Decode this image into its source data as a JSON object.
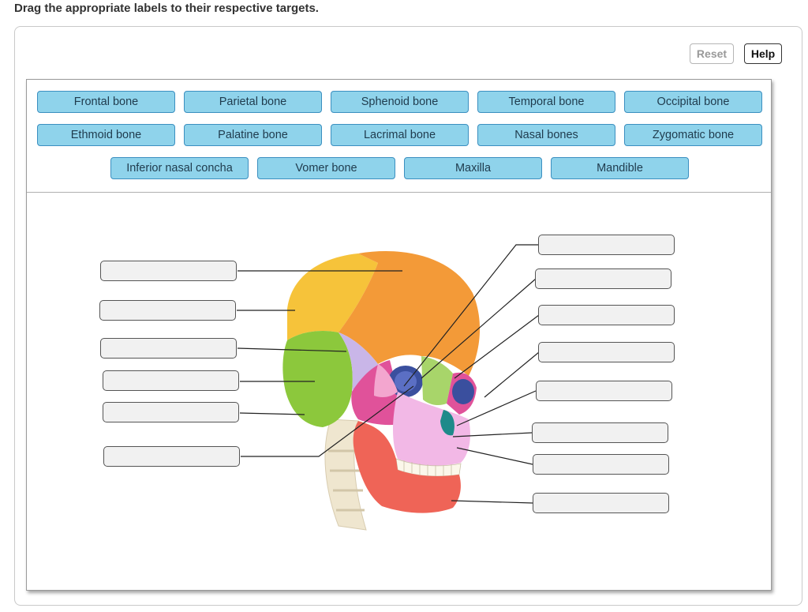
{
  "instruction": "Drag the appropriate labels to their respective targets.",
  "toolbar": {
    "reset_label": "Reset",
    "help_label": "Help"
  },
  "labels": [
    "Frontal bone",
    "Parietal bone",
    "Sphenoid bone",
    "Temporal bone",
    "Occipital bone",
    "Ethmoid bone",
    "Palatine bone",
    "Lacrimal bone",
    "Nasal bones",
    "Zygomatic bone",
    "Inferior nasal concha",
    "Vomer bone",
    "Maxilla",
    "Mandible"
  ],
  "colors": {
    "chip_fill": "#8fd3eb",
    "chip_border": "#3b8fc0",
    "frontal": "#f39a38",
    "parietal": "#f6c33a",
    "occipital": "#8cc83c",
    "temporal": "#c9b6e8",
    "sphenoid": "#e0529a",
    "maxilla": "#f2b8e6",
    "mandible": "#ef6457"
  }
}
